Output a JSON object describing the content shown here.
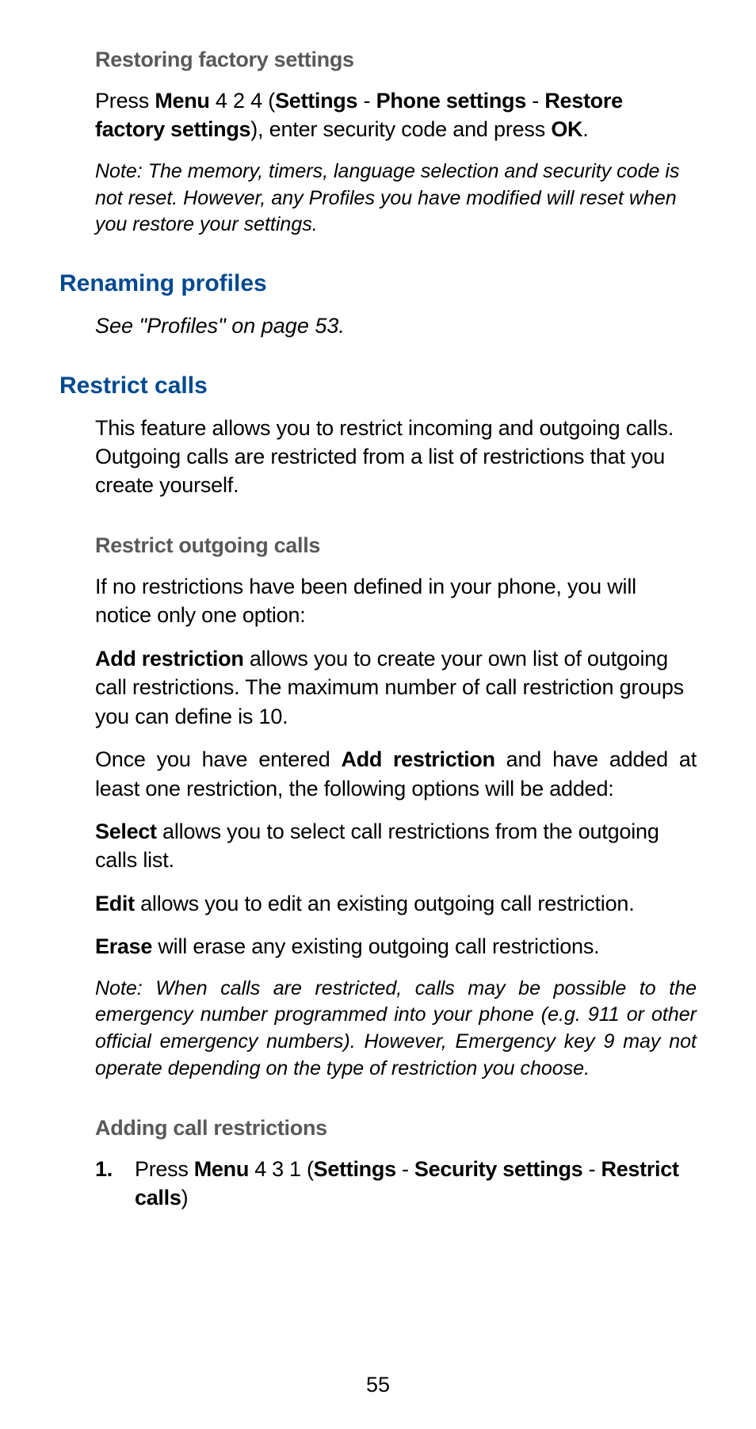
{
  "page_number": "55",
  "colors": {
    "blue": "#004990",
    "gray": "#59595b"
  },
  "s1": {
    "heading": "Restoring factory settings",
    "p1_runs": {
      "r0": "Press ",
      "r1_b": "Menu",
      "r2": " 4 2 4 (",
      "r3_b": "Settings",
      "r4": " - ",
      "r5_b": "Phone settings",
      "r6": " - ",
      "r7_b": "Restore factory settings",
      "r8": "), enter security code and press ",
      "r9_b": "OK",
      "r10": "."
    },
    "note": "Note: The memory, timers, language selection and security code is not reset. However, any Profiles you have modified will reset when you restore your settings."
  },
  "s2": {
    "heading": "Renaming profiles",
    "p1": "See \"Profiles\" on page 53."
  },
  "s3": {
    "heading": "Restrict calls",
    "p1": "This feature allows you to restrict incoming and outgoing calls. Outgoing calls are restricted from a list of restrictions that you create yourself.",
    "sub1_heading": "Restrict outgoing calls",
    "sub1_p1": "If no restrictions have been defined in your phone, you will notice only one option:",
    "sub1_p2_runs": {
      "r0_b": "Add restriction",
      "r1": " allows you to create your own list of outgoing call restrictions. The maximum number of call restriction groups you can define is 10."
    },
    "sub1_p3_runs": {
      "r0": "Once you have entered ",
      "r1_b": "Add restriction",
      "r2": " and have added at least one restriction, the following options will be added:"
    },
    "sub1_p4_runs": {
      "r0_b": "Select",
      "r1": " allows you to select call restrictions from the outgoing calls list."
    },
    "sub1_p5_runs": {
      "r0_b": "Edit",
      "r1": " allows you to edit an existing outgoing call restriction."
    },
    "sub1_p6_runs": {
      "r0_b": "Erase",
      "r1": " will erase any existing outgoing call restrictions."
    },
    "sub1_note": "Note: When calls are restricted, calls may be possible to the emergency number programmed into your phone (e.g. 911 or other official emergency numbers). However, Emergency key 9 may not operate depending on the type of restriction you choose.",
    "sub2_heading": "Adding call restrictions",
    "sub2_step1_runs": {
      "num": "1.",
      "r0": "Press ",
      "r1_b": "Menu",
      "r2": " 4 3 1 (",
      "r3_b": "Settings",
      "r4": " - ",
      "r5_b": "Security settings",
      "r6": " - ",
      "r7_b": "Restrict calls",
      "r8": ")"
    }
  }
}
